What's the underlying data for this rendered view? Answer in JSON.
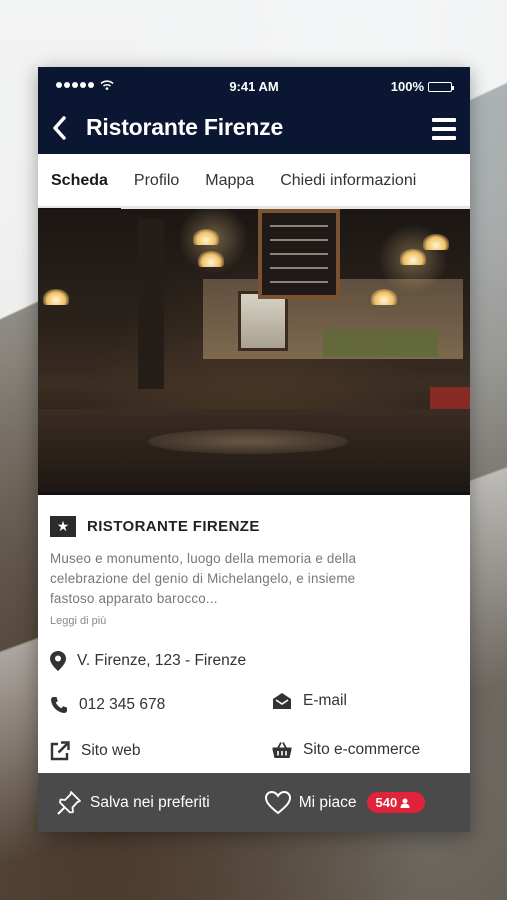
{
  "status_bar": {
    "time": "9:41 AM",
    "battery": "100%"
  },
  "header": {
    "title": "Ristorante Firenze"
  },
  "tabs": [
    {
      "label": "Scheda",
      "active": true
    },
    {
      "label": "Profilo",
      "active": false
    },
    {
      "label": "Mappa",
      "active": false
    },
    {
      "label": "Chiedi informazioni",
      "active": false
    }
  ],
  "place": {
    "name": "RISTORANTE FIRENZE",
    "description": "Museo e monumento, luogo della memoria e della celebrazione del genio di Michelangelo, e insieme fastoso apparato barocco...",
    "read_more": "Leggi di più"
  },
  "contacts": {
    "address": "V. Firenze, 123 - Firenze",
    "phone": "012 345 678",
    "email": "E-mail",
    "website": "Sito web",
    "shop": "Sito e-commerce"
  },
  "bottom_bar": {
    "save": "Salva nei preferiti",
    "like": "Mi piace",
    "like_count": "540"
  },
  "colors": {
    "header_bg": "#0b1633",
    "bottom_bg": "#4a4a4a",
    "badge": "#e0233a"
  },
  "icons": [
    "back-chevron-icon",
    "hamburger-menu-icon",
    "star-icon",
    "map-pin-icon",
    "phone-icon",
    "envelope-icon",
    "external-link-icon",
    "basket-icon",
    "pin-icon",
    "heart-icon",
    "user-icon"
  ]
}
